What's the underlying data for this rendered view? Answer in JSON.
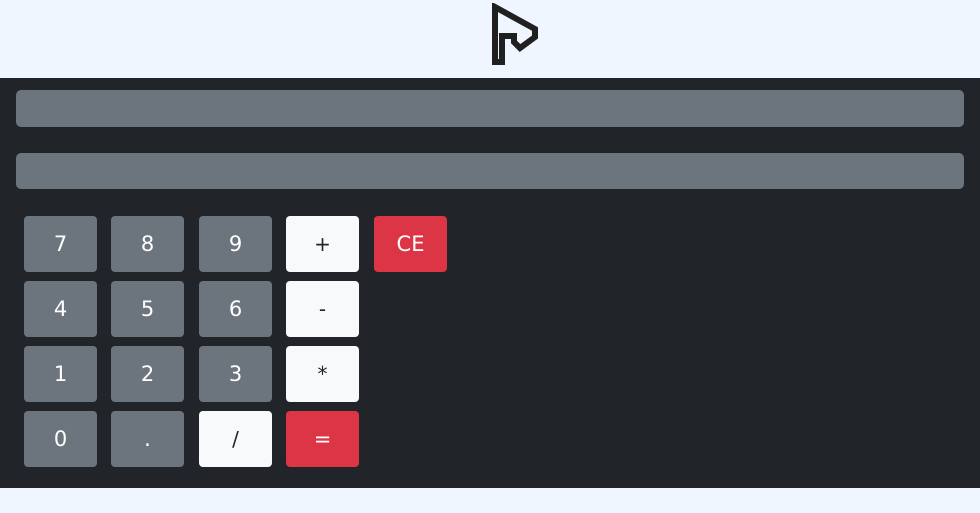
{
  "logo": {
    "icon": "fp-logo-icon"
  },
  "calculator": {
    "display_expression": "",
    "display_result": "",
    "keys": {
      "seven": "7",
      "eight": "8",
      "nine": "9",
      "plus": "+",
      "clear": "CE",
      "four": "4",
      "five": "5",
      "six": "6",
      "minus": "-",
      "one": "1",
      "two": "2",
      "three": "3",
      "multiply": "*",
      "zero": "0",
      "decimal": ".",
      "divide": "/",
      "equals": "="
    }
  },
  "colors": {
    "page_background": "#f0f6ff",
    "calculator_background": "#212429",
    "display_background": "#6c757d",
    "number_key": "#6c757d",
    "operator_key": "#f8f9fa",
    "accent_key": "#dc3545"
  }
}
